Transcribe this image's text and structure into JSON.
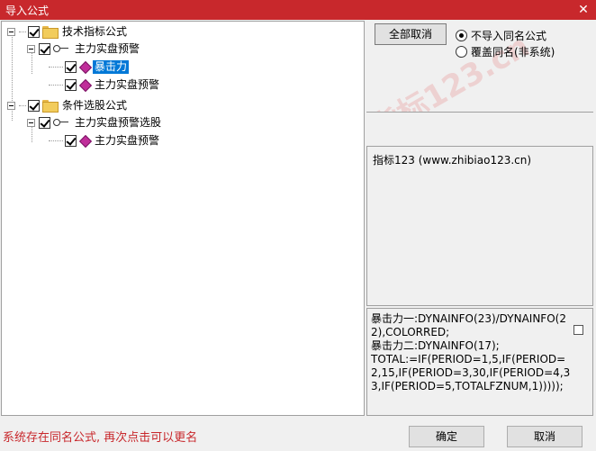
{
  "window": {
    "title": "导入公式",
    "close_glyph": "✕"
  },
  "tree": {
    "root1": {
      "label": "技术指标公式"
    },
    "root1_child": {
      "label": "主力实盘预警"
    },
    "root1_leaf1": {
      "label": "暴击力"
    },
    "root1_leaf2": {
      "label": "主力实盘预警"
    },
    "root2": {
      "label": "条件选股公式"
    },
    "root2_child": {
      "label": "主力实盘预警选股"
    },
    "root2_leaf1": {
      "label": "主力实盘预警"
    }
  },
  "buttons": {
    "cancel_all": "全部取消",
    "ok": "确定",
    "cancel": "取消"
  },
  "radios": {
    "no_import_same": "不导入同名公式",
    "overwrite_same": "覆盖同名(非系统)"
  },
  "info": {
    "text": "指标123   (www.zhibiao123.cn)"
  },
  "code": {
    "text": "暴击力一:DYNAINFO(23)/DYNAINFO(22),COLORRED;\n暴击力二:DYNAINFO(17);\nTOTAL:=IF(PERIOD=1,5,IF(PERIOD=2,15,IF(PERIOD=3,30,IF(PERIOD=4,33,IF(PERIOD=5,TOTALFZNUM,1)))));"
  },
  "status": {
    "text": "系统存在同名公式, 再次点击可以更名"
  },
  "watermark": {
    "text": "指标123.cn"
  },
  "colors": {
    "titlebar": "#c8282c",
    "selection": "#0078d7",
    "status": "#c8282c"
  }
}
